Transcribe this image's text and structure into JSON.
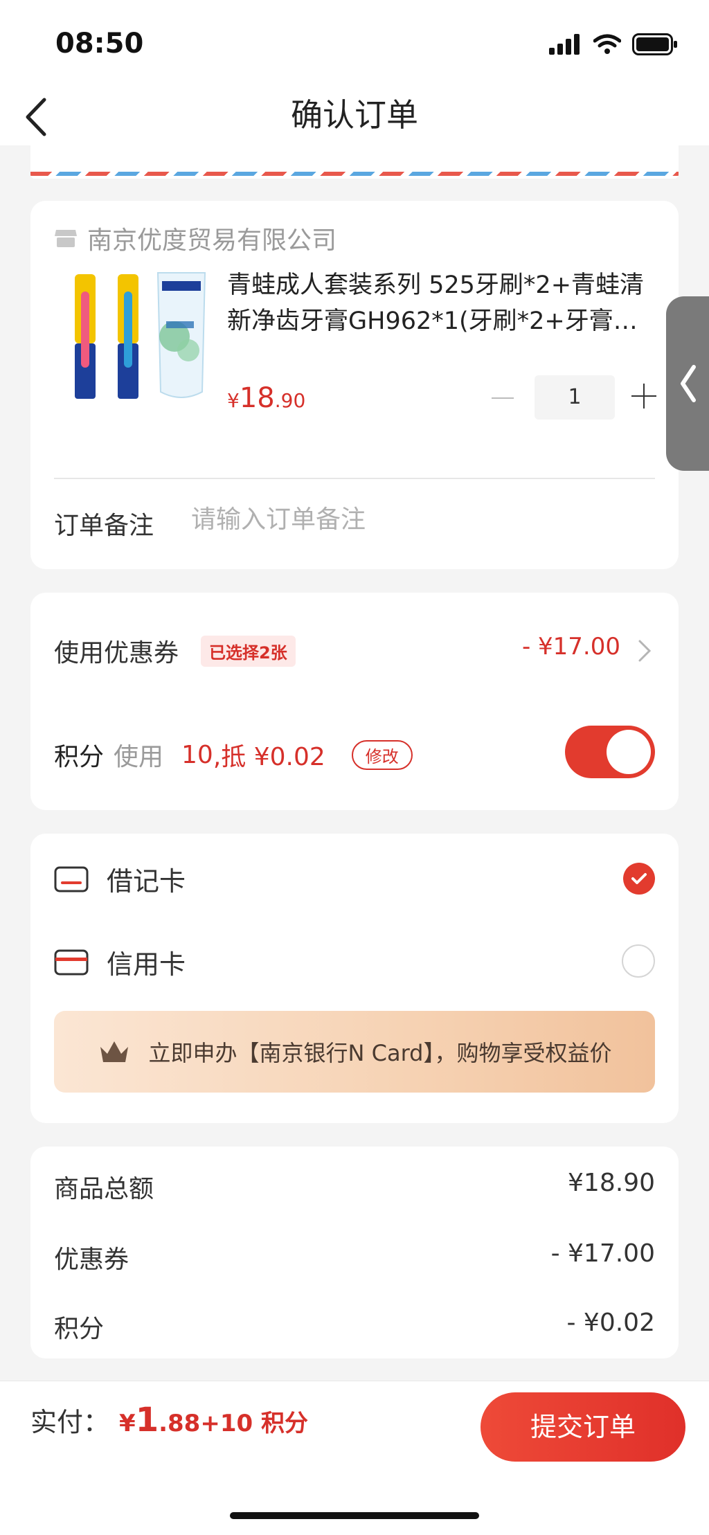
{
  "status_bar": {
    "time": "08:50"
  },
  "header": {
    "title": "确认订单"
  },
  "shop": {
    "name": "南京优度贸易有限公司",
    "product": {
      "title": "青蛙成人套装系列 525牙刷*2+青蛙清新净齿牙膏GH962*1(牙刷*2+牙膏*1)",
      "price_symbol": "¥",
      "price_int": "18",
      "price_dec": ".90",
      "quantity": "1"
    },
    "remark": {
      "label": "订单备注",
      "placeholder": "请输入订单备注"
    }
  },
  "discounts": {
    "coupon_label": "使用优惠券",
    "coupon_badge": "已选择2张",
    "coupon_amount": "- ¥17.00",
    "points_label": "积分",
    "points_use": "使用",
    "points_num": "10",
    "points_offset": ",抵 ¥0.02",
    "modify_label": "修改",
    "points_enabled": true
  },
  "payment": {
    "debit_label": "借记卡",
    "credit_label": "信用卡",
    "selected": "debit",
    "promo_text": "立即申办【南京银行N Card】，购物享受权益价"
  },
  "summary": {
    "rows": [
      {
        "label": "商品总额",
        "value": "¥18.90"
      },
      {
        "label": "优惠券",
        "value": "- ¥17.00"
      },
      {
        "label": "积分",
        "value": "- ¥0.02"
      }
    ]
  },
  "footer": {
    "pay_label": "实付：",
    "pay_yen": "¥",
    "pay_big": "1",
    "pay_tail": ".88+10 积分",
    "submit_label": "提交订单"
  },
  "colors": {
    "accent": "#e23b2e",
    "price_red": "#d6302a",
    "background": "#f4f4f4"
  }
}
